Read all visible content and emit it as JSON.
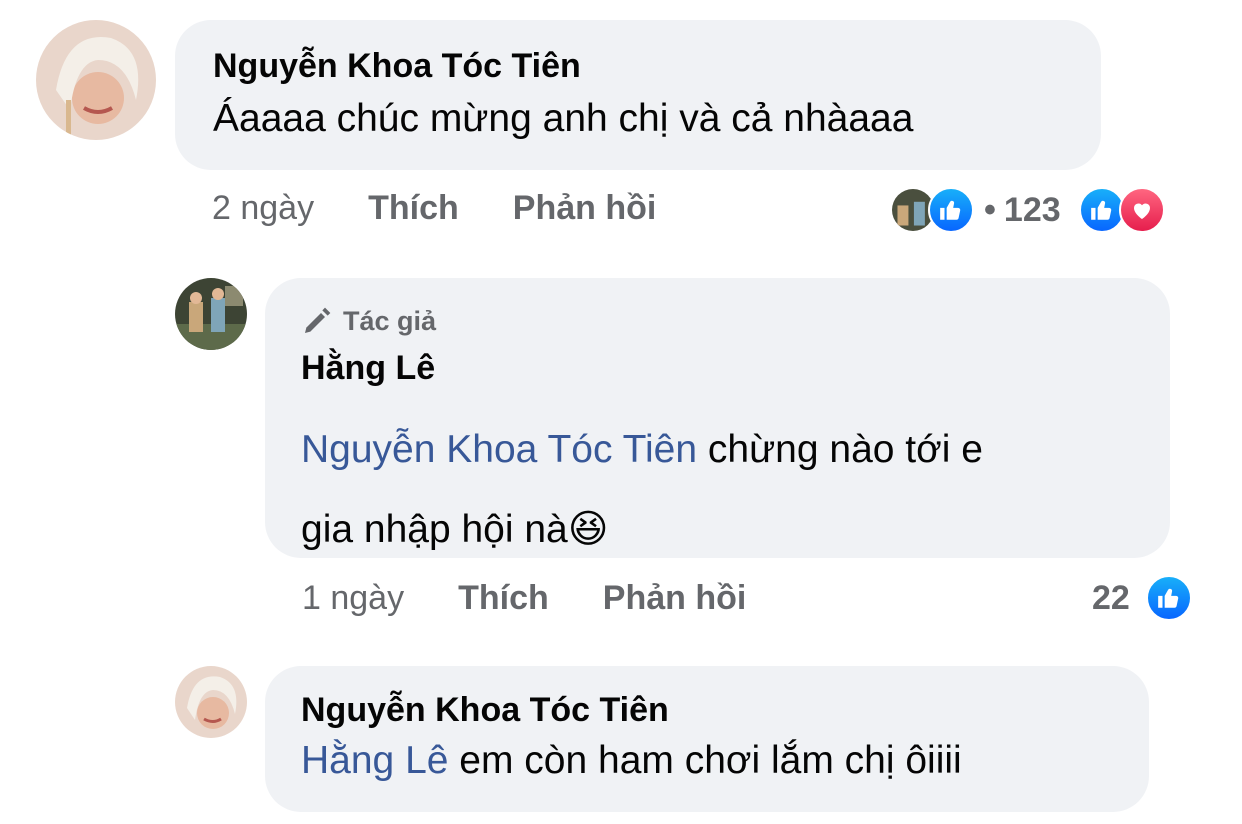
{
  "comments": [
    {
      "author": "Nguyễn Khoa Tóc Tiên",
      "text": "Áaaaa chúc mừng anh chị và cả nhàaaa",
      "time": "2 ngày",
      "like_label": "Thích",
      "reply_label": "Phản hồi",
      "reaction_count": "123",
      "reaction_separator": "•"
    },
    {
      "badge": "Tác giả",
      "author": "Hằng Lê",
      "mention": "Nguyễn Khoa Tóc Tiên",
      "text_line1": " chừng nào tới e",
      "text_line2": "gia nhập hội nà",
      "emoji": "😆",
      "time": "1 ngày",
      "like_label": "Thích",
      "reply_label": "Phản hồi",
      "reaction_count": "22"
    },
    {
      "author": "Nguyễn Khoa Tóc Tiên",
      "mention": "Hằng Lê",
      "text": " em còn ham chơi lắm chị ôiiii"
    }
  ],
  "icons": {
    "like": "like-icon",
    "love": "love-icon",
    "author_badge": "pen-icon"
  },
  "colors": {
    "bubble": "#f0f2f5",
    "mention": "#385898",
    "secondary_text": "#65676b",
    "like_blue": "#0866ff",
    "love_red": "#e61e4d"
  }
}
